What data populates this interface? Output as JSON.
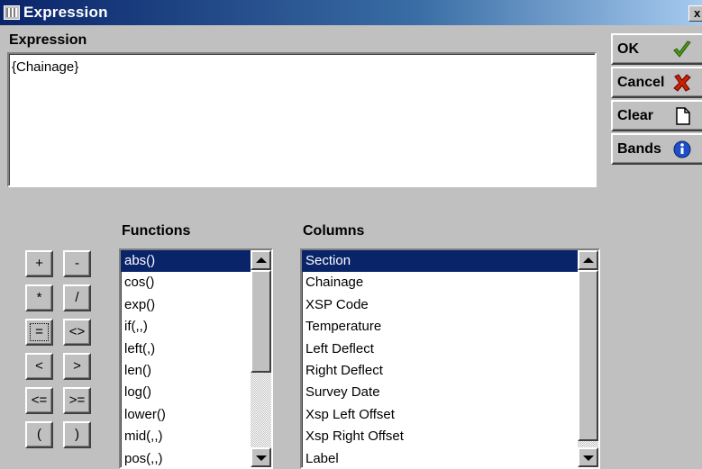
{
  "window": {
    "title": "Expression",
    "close_glyph": "x"
  },
  "expression": {
    "label": "Expression",
    "value": "{Chainage}"
  },
  "buttons": {
    "ok": {
      "label": "OK",
      "icon": "checkmark-icon"
    },
    "cancel": {
      "label": "Cancel",
      "icon": "x-icon"
    },
    "clear": {
      "label": "Clear",
      "icon": "document-icon"
    },
    "bands": {
      "label": "Bands",
      "icon": "info-icon"
    }
  },
  "operators": [
    [
      "+",
      "-"
    ],
    [
      "*",
      "/"
    ],
    [
      "=",
      "<>"
    ],
    [
      "<",
      ">"
    ],
    [
      "<=",
      ">="
    ],
    [
      "(",
      ")"
    ]
  ],
  "functions": {
    "label": "Functions",
    "selected": 0,
    "items": [
      "abs()",
      "cos()",
      "exp()",
      "if(,,)",
      "left(,)",
      "len()",
      "log()",
      "lower()",
      "mid(,,)",
      "pos(,,)"
    ]
  },
  "columns": {
    "label": "Columns",
    "selected": 0,
    "items": [
      "Section",
      "Chainage",
      "XSP Code",
      "Temperature",
      "Left Deflect",
      "Right Deflect",
      "Survey Date",
      "Xsp Left Offset",
      "Xsp Right Offset",
      "Label"
    ]
  },
  "colors": {
    "selection": "#0a246a",
    "ok_check": "#4a9a1a",
    "cancel_x": "#cc2200",
    "info": "#1f4fc8"
  }
}
